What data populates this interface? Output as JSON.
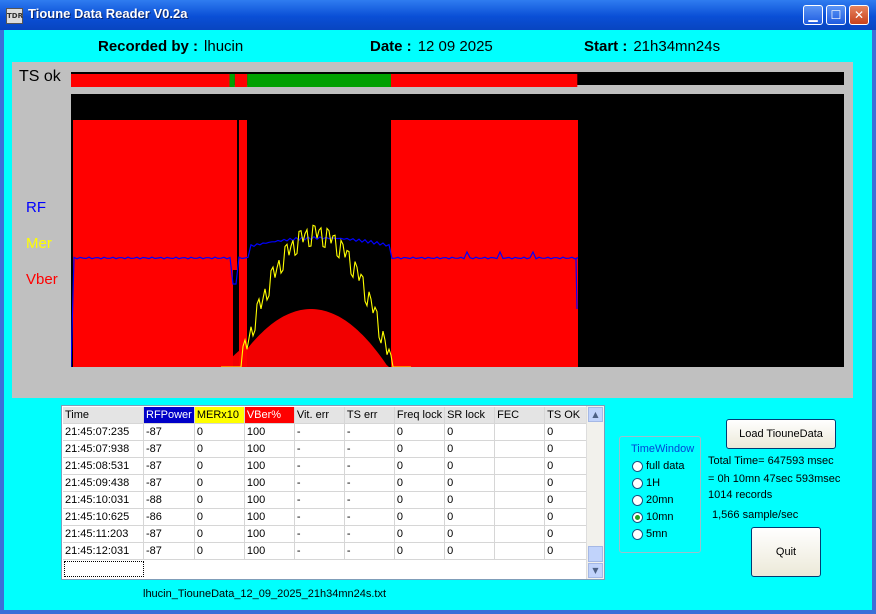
{
  "window": {
    "title": "Tioune Data Reader V0.2a",
    "icon": "TDR"
  },
  "header": {
    "recorded_label": "Recorded by :",
    "recorded_value": "lhucin",
    "date_label": "Date :",
    "date_value": "12 09 2025",
    "start_label": "Start :",
    "start_value": "21h34mn24s"
  },
  "plot": {
    "ts_label": "TS ok",
    "legend": {
      "rf": "RF",
      "mer": "Mer",
      "vber": "Vber"
    },
    "colors": {
      "rf": "#0000ff",
      "mer": "#ffff00",
      "vber": "#ff0000",
      "ts_ok": "#00a000",
      "ts_bad": "#ff0000",
      "background": "#000000"
    }
  },
  "chart_data": {
    "type": "area",
    "series": [
      {
        "name": "RF"
      },
      {
        "name": "Mer"
      },
      {
        "name": "Vber"
      }
    ],
    "ts_ok_segments": [
      {
        "state": "bad",
        "from": 0.0,
        "to": 0.205
      },
      {
        "state": "ok",
        "from": 0.205,
        "to": 0.212
      },
      {
        "state": "bad",
        "from": 0.212,
        "to": 0.228
      },
      {
        "state": "ok",
        "from": 0.228,
        "to": 0.414
      },
      {
        "state": "bad",
        "from": 0.414,
        "to": 0.655
      },
      {
        "state": "none",
        "from": 0.655,
        "to": 1.0
      }
    ]
  },
  "grid": {
    "columns": [
      "Time",
      "RFPower",
      "MERx10",
      "VBer%",
      "Vit. err",
      "TS err",
      "Freq lock",
      "SR lock",
      "FEC",
      "TS OK"
    ],
    "rows": [
      [
        "21:45:07:235",
        "-87",
        "0",
        "100",
        "-",
        "-",
        "0",
        "0",
        "",
        "0"
      ],
      [
        "21:45:07:938",
        "-87",
        "0",
        "100",
        "-",
        "-",
        "0",
        "0",
        "",
        "0"
      ],
      [
        "21:45:08:531",
        "-87",
        "0",
        "100",
        "-",
        "-",
        "0",
        "0",
        "",
        "0"
      ],
      [
        "21:45:09:438",
        "-87",
        "0",
        "100",
        "-",
        "-",
        "0",
        "0",
        "",
        "0"
      ],
      [
        "21:45:10:031",
        "-88",
        "0",
        "100",
        "-",
        "-",
        "0",
        "0",
        "",
        "0"
      ],
      [
        "21:45:10:625",
        "-86",
        "0",
        "100",
        "-",
        "-",
        "0",
        "0",
        "",
        "0"
      ],
      [
        "21:45:11:203",
        "-87",
        "0",
        "100",
        "-",
        "-",
        "0",
        "0",
        "",
        "0"
      ],
      [
        "21:45:12:031",
        "-87",
        "0",
        "100",
        "-",
        "-",
        "0",
        "0",
        "",
        "0"
      ]
    ],
    "scroll_up_icon": "arrow-up-icon",
    "scroll_down_icon": "arrow-down-icon"
  },
  "filename": "lhucin_TiouneData_12_09_2025_21h34mn24s.txt",
  "time_window": {
    "label": "TimeWindow",
    "options": [
      "full data",
      "1H",
      "20mn",
      "10mn",
      "5mn"
    ],
    "selected": "10mn"
  },
  "buttons": {
    "load": "Load TiouneData",
    "quit": "Quit"
  },
  "info": {
    "total": "Total Time= 647593 msec",
    "breakdown": "= 0h 10mn 47sec 593msec",
    "records": "1014 records",
    "rate": "1,566 sample/sec"
  }
}
